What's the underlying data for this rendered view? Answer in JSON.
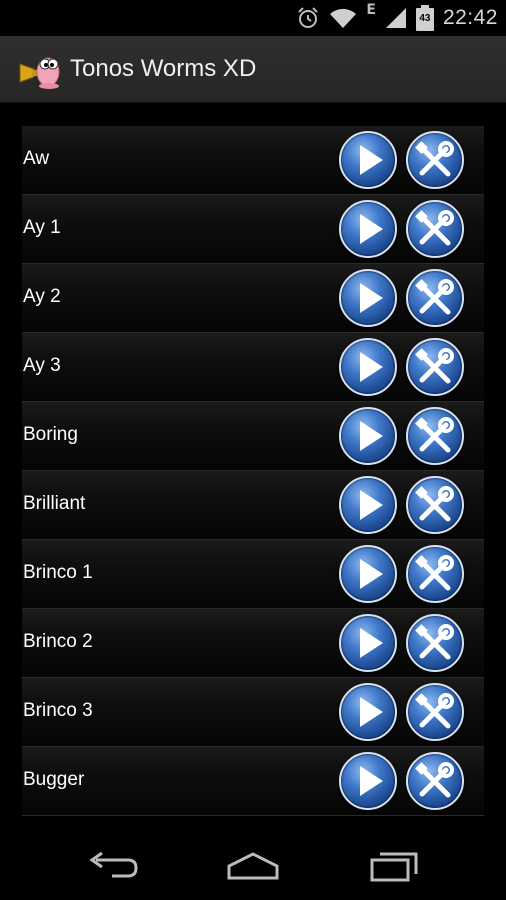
{
  "status": {
    "time": "22:42",
    "network_label": "E",
    "battery_level": "43",
    "icons": [
      "alarm-icon",
      "wifi-icon",
      "signal-icon",
      "battery-icon"
    ]
  },
  "app": {
    "title": "Tonos Worms XD",
    "icon": "worm-trumpet-logo"
  },
  "sounds": [
    {
      "label": "Aw"
    },
    {
      "label": "Ay 1"
    },
    {
      "label": "Ay 2"
    },
    {
      "label": "Ay 3"
    },
    {
      "label": "Boring"
    },
    {
      "label": "Brilliant"
    },
    {
      "label": "Brinco 1"
    },
    {
      "label": "Brinco 2"
    },
    {
      "label": "Brinco 3"
    },
    {
      "label": "Bugger"
    }
  ],
  "row_actions": {
    "play_icon": "play-icon",
    "settings_icon": "tools-icon"
  },
  "colors": {
    "button_blue": "#2f63b3",
    "button_border": "#d7e2f2",
    "action_bar": "#2b2b2b"
  },
  "nav": [
    "back-icon",
    "home-icon",
    "recents-icon"
  ]
}
